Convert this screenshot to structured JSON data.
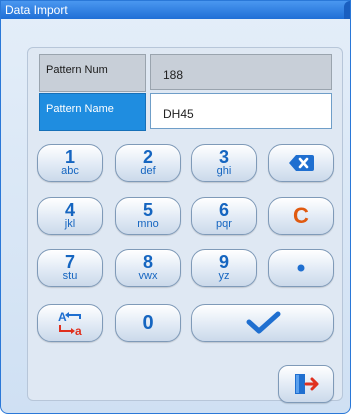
{
  "window": {
    "title": "Data Import"
  },
  "fields": {
    "pattern_num": {
      "label": "Pattern Num",
      "value": "188"
    },
    "pattern_name": {
      "label": "Pattern Name",
      "value": "DH45"
    }
  },
  "keypad": {
    "keys": [
      {
        "num": "1",
        "sub": "abc"
      },
      {
        "num": "2",
        "sub": "def"
      },
      {
        "num": "3",
        "sub": "ghi"
      },
      {
        "num": "4",
        "sub": "jkl"
      },
      {
        "num": "5",
        "sub": "mno"
      },
      {
        "num": "6",
        "sub": "pqr"
      },
      {
        "num": "7",
        "sub": "stu"
      },
      {
        "num": "8",
        "sub": "vwx"
      },
      {
        "num": "9",
        "sub": "yz"
      }
    ],
    "clear_label": "C",
    "zero_label": "0",
    "icons": {
      "backspace": "backspace-icon",
      "dot": "dot-icon",
      "switch_case": "switch-case-icon",
      "confirm": "checkmark-icon",
      "exit": "exit-door-icon"
    },
    "colors": {
      "accent": "#1565c0",
      "clear": "#e05a10",
      "selected_label": "#1f8de0"
    }
  }
}
